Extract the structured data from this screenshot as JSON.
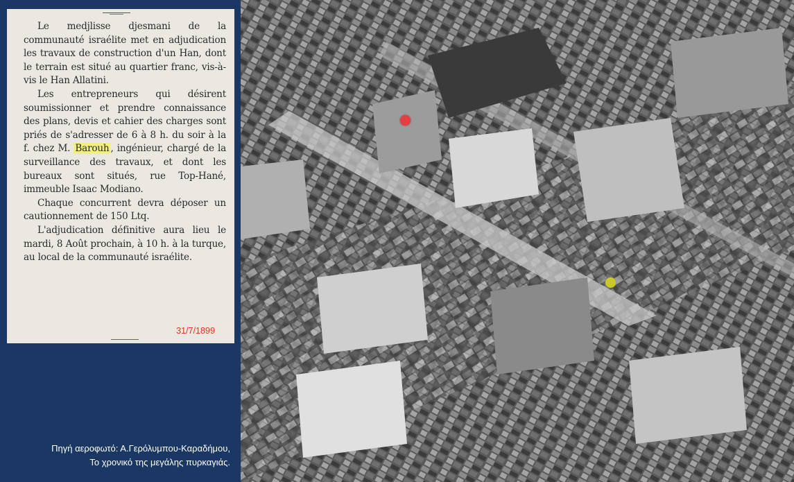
{
  "clipping": {
    "paragraphs": [
      "Le medjlisse djesmani de la communauté israélite met en adjudication les travaux de construction d'un Han, dont le terrain est situé au quartier franc, vis-à-vis le Han Allatini.",
      "Les entrepreneurs qui désirent soumissionner et prendre connaissance des plans, devis et cahier des charges sont priés de s'adresser de 6 à 8 h. du soir à la f. chez M.",
      "Barouh",
      "ingénieur, chargé de la surveillance des travaux, et dont les bureaux sont situés, rue Top-Hané, immeuble Isaac Modiano.",
      "Chaque concurrent devra déposer un cautionnement de 150 Ltq.",
      "L'adjudication définitive aura lieu le mardi, 8 Août prochain, à 10 h. à la turque, au local de la communauté israélite."
    ],
    "date": "31/7/1899",
    "highlight_color": "#f3ee83"
  },
  "caption": {
    "line1": "Πηγή αεροφωτό: Α.Γερόλυμπου-Καραδήμου,",
    "line2": "Το χρονικό της μεγάλης πυρκαγιάς."
  },
  "photo": {
    "markers": [
      {
        "name": "red-marker",
        "color": "#e24040"
      },
      {
        "name": "yellow-marker",
        "color": "#c9c72a"
      }
    ]
  },
  "colors": {
    "panel_background": "#1b3764",
    "paper": "#ebe8e1",
    "date_red": "#e03428"
  }
}
